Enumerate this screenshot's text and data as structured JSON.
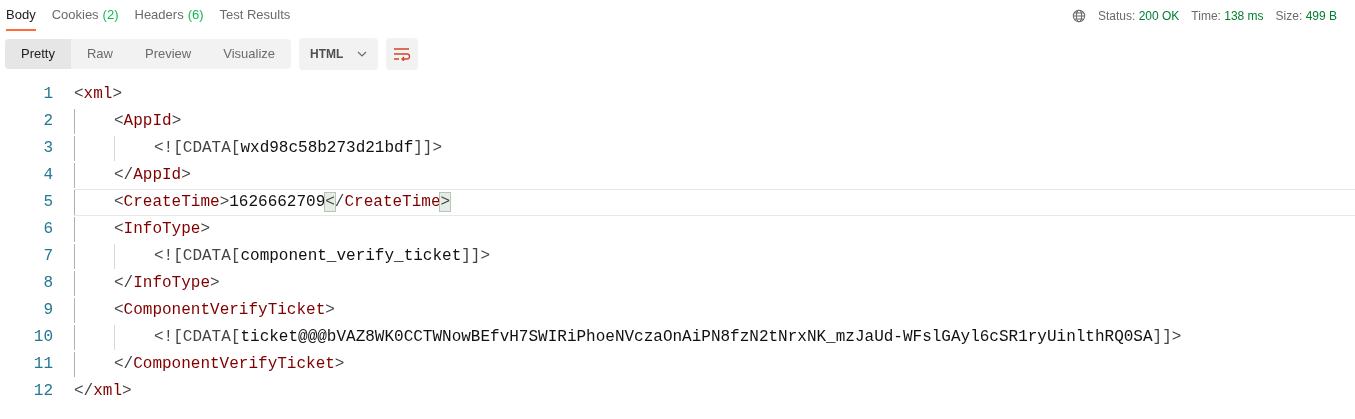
{
  "tabs": [
    {
      "label": "Body",
      "selected": true
    },
    {
      "label": "Cookies",
      "count": "(2)",
      "selected": false
    },
    {
      "label": "Headers",
      "count": "(6)",
      "selected": false
    },
    {
      "label": "Test Results",
      "selected": false
    }
  ],
  "status": [
    {
      "label": "Status:",
      "value": "200 OK"
    },
    {
      "label": "Time:",
      "value": "138 ms"
    },
    {
      "label": "Size:",
      "value": "499 B"
    }
  ],
  "view_modes": [
    {
      "label": "Pretty",
      "selected": true
    },
    {
      "label": "Raw",
      "selected": false
    },
    {
      "label": "Preview",
      "selected": false
    },
    {
      "label": "Visualize",
      "selected": false
    }
  ],
  "format_select": {
    "value": "HTML"
  },
  "code": [
    {
      "number": "1",
      "current": false,
      "tokens": [
        {
          "kind": "bracket",
          "text": "<"
        },
        {
          "kind": "tag",
          "text": "xml"
        },
        {
          "kind": "bracket",
          "text": ">"
        }
      ],
      "children": [
        {
          "number": "2",
          "current": false,
          "tokens": [
            {
              "kind": "bracket",
              "text": "<"
            },
            {
              "kind": "tag",
              "text": "AppId"
            },
            {
              "kind": "bracket",
              "text": ">"
            }
          ],
          "children": [
            {
              "number": "3",
              "current": false,
              "tokens": [
                {
                  "kind": "bracket",
                  "text": "<![CDATA["
                },
                {
                  "kind": "text",
                  "text": "wxd98c58b273d21bdf"
                },
                {
                  "kind": "bracket",
                  "text": "]]>"
                }
              ]
            }
          ]
        },
        {
          "number": "4",
          "current": false,
          "tokens": [
            {
              "kind": "bracket",
              "text": "</"
            },
            {
              "kind": "tag",
              "text": "AppId"
            },
            {
              "kind": "bracket",
              "text": ">"
            }
          ]
        },
        {
          "number": "5",
          "current": true,
          "tokens": [
            {
              "kind": "bracket",
              "text": "<"
            },
            {
              "kind": "tag",
              "text": "CreateTime"
            },
            {
              "kind": "bracket",
              "text": ">"
            },
            {
              "kind": "text",
              "text": "1626662709"
            },
            {
              "kind": "match",
              "text": "<"
            },
            {
              "kind": "bracket",
              "text": "/"
            },
            {
              "kind": "tag",
              "text": "CreateTime"
            },
            {
              "kind": "match",
              "text": ">"
            }
          ]
        },
        {
          "number": "6",
          "current": false,
          "tokens": [
            {
              "kind": "bracket",
              "text": "<"
            },
            {
              "kind": "tag",
              "text": "InfoType"
            },
            {
              "kind": "bracket",
              "text": ">"
            }
          ],
          "children": [
            {
              "number": "7",
              "current": false,
              "tokens": [
                {
                  "kind": "bracket",
                  "text": "<![CDATA["
                },
                {
                  "kind": "text",
                  "text": "component_verify_ticket"
                },
                {
                  "kind": "bracket",
                  "text": "]]>"
                }
              ]
            }
          ]
        },
        {
          "number": "8",
          "current": false,
          "tokens": [
            {
              "kind": "bracket",
              "text": "</"
            },
            {
              "kind": "tag",
              "text": "InfoType"
            },
            {
              "kind": "bracket",
              "text": ">"
            }
          ]
        },
        {
          "number": "9",
          "current": false,
          "tokens": [
            {
              "kind": "bracket",
              "text": "<"
            },
            {
              "kind": "tag",
              "text": "ComponentVerifyTicket"
            },
            {
              "kind": "bracket",
              "text": ">"
            }
          ],
          "children": [
            {
              "number": "10",
              "current": false,
              "tokens": [
                {
                  "kind": "bracket",
                  "text": "<![CDATA["
                },
                {
                  "kind": "text",
                  "text": "ticket@@@bVAZ8WK0CCTWNowBEfvH7SWIRiPhoeNVczaOnAiPN8fzN2tNrxNK_mzJaUd-WFslGAyl6cSR1ryUinlthRQ0SA"
                },
                {
                  "kind": "bracket",
                  "text": "]]>"
                }
              ]
            }
          ]
        },
        {
          "number": "11",
          "current": false,
          "tokens": [
            {
              "kind": "bracket",
              "text": "</"
            },
            {
              "kind": "tag",
              "text": "ComponentVerifyTicket"
            },
            {
              "kind": "bracket",
              "text": ">"
            }
          ]
        }
      ]
    },
    {
      "number": "12",
      "current": false,
      "tokens": [
        {
          "kind": "bracket",
          "text": "</"
        },
        {
          "kind": "tag",
          "text": "xml"
        },
        {
          "kind": "bracket",
          "text": ">"
        }
      ]
    }
  ]
}
